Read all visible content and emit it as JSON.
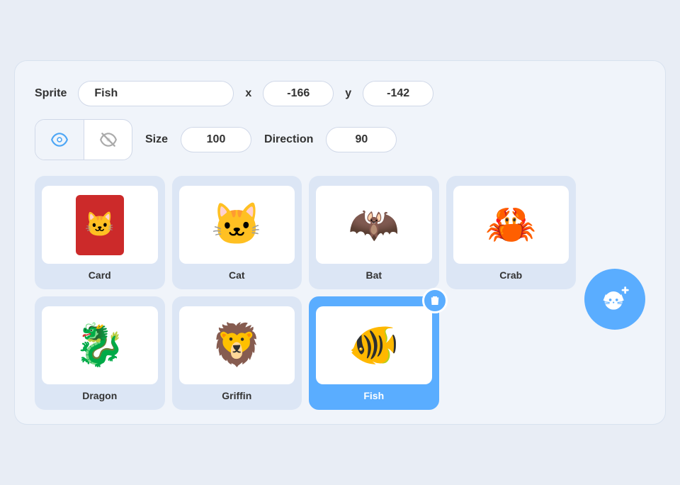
{
  "header": {
    "sprite_label": "Sprite",
    "sprite_name": "Fish",
    "x_label": "x",
    "x_value": "-166",
    "y_label": "y",
    "y_value": "-142",
    "size_label": "Size",
    "size_value": "100",
    "direction_label": "Direction",
    "direction_value": "90"
  },
  "visibility": {
    "show_label": "show",
    "hide_label": "hide"
  },
  "sprites": [
    {
      "id": "card",
      "label": "Card",
      "emoji": "🃏",
      "type": "card"
    },
    {
      "id": "cat",
      "label": "Cat",
      "emoji": "🐱",
      "type": "emoji"
    },
    {
      "id": "bat",
      "label": "Bat",
      "emoji": "🦇",
      "type": "emoji"
    },
    {
      "id": "crab",
      "label": "Crab",
      "emoji": "🦀",
      "type": "emoji"
    },
    {
      "id": "dragon",
      "label": "Dragon",
      "emoji": "🐉",
      "type": "emoji"
    },
    {
      "id": "griffin",
      "label": "Griffin",
      "emoji": "🦁",
      "type": "emoji"
    },
    {
      "id": "fish",
      "label": "Fish",
      "emoji": "🐠",
      "type": "emoji",
      "selected": true,
      "deletable": true
    }
  ],
  "add_button": {
    "label": "add sprite"
  }
}
